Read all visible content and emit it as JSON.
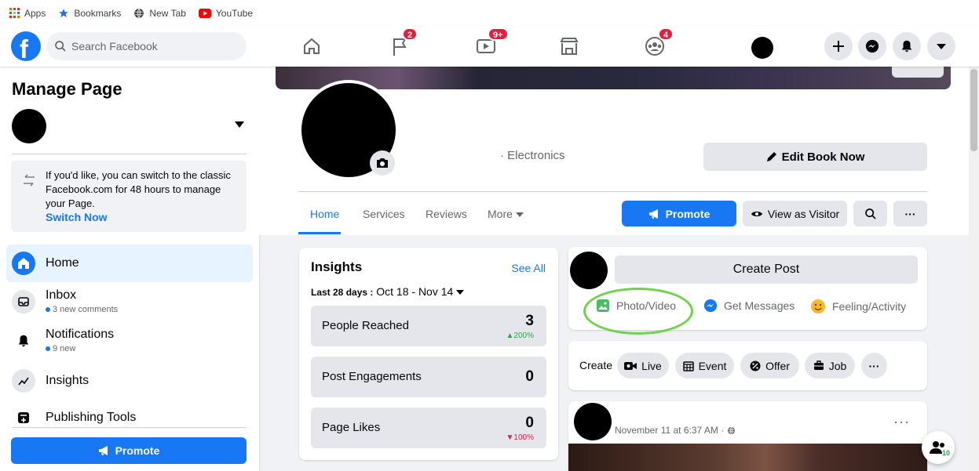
{
  "bookmarks_bar": {
    "items": [
      {
        "label": "Apps",
        "icon": "apps-grid-icon"
      },
      {
        "label": "Bookmarks",
        "icon": "star-icon"
      },
      {
        "label": "New Tab",
        "icon": "globe-icon"
      },
      {
        "label": "YouTube",
        "icon": "youtube-icon"
      }
    ]
  },
  "topnav": {
    "search_placeholder": "Search Facebook",
    "badges": {
      "flag": "2",
      "watch": "9+",
      "groups": "4"
    }
  },
  "sidebar": {
    "title": "Manage Page",
    "classic_notice": "If you'd like, you can switch to the classic Facebook.com for 48 hours to manage your Page.",
    "switch_link": "Switch Now",
    "items": [
      {
        "label": "Home",
        "sub": ""
      },
      {
        "label": "Inbox",
        "sub": "3 new comments"
      },
      {
        "label": "Notifications",
        "sub": "9 new"
      },
      {
        "label": "Insights",
        "sub": ""
      },
      {
        "label": "Publishing Tools",
        "sub": ""
      }
    ],
    "promote": "Promote"
  },
  "header": {
    "category": "· Electronics",
    "edit_book": "Edit Book Now",
    "tabs": [
      "Home",
      "Services",
      "Reviews",
      "More"
    ],
    "promote": "Promote",
    "view_as_visitor": "View as Visitor",
    "more_dots": "···"
  },
  "insights": {
    "title": "Insights",
    "see_all": "See All",
    "range_label": "Last 28 days :",
    "range_value": "Oct 18 - Nov 14",
    "metrics": [
      {
        "label": "People Reached",
        "value": "3",
        "change": "▲200%"
      },
      {
        "label": "Post Engagements",
        "value": "0",
        "change": ""
      },
      {
        "label": "Page Likes",
        "value": "0",
        "change": "▼100%"
      }
    ]
  },
  "create_post": {
    "button": "Create Post",
    "options": [
      "Photo/Video",
      "Get Messages",
      "Feeling/Activity"
    ]
  },
  "create_bar": {
    "label": "Create",
    "items": [
      "Live",
      "Event",
      "Offer",
      "Job"
    ],
    "more": "···"
  },
  "post": {
    "date": "November 11 at 6:37 AM ·",
    "more": "···"
  },
  "contacts": {
    "count": "10"
  },
  "colors": {
    "brand": "#1877f2",
    "badge": "#e41e3f",
    "highlight_ring": "#6ed24a",
    "up": "#31a24c"
  }
}
